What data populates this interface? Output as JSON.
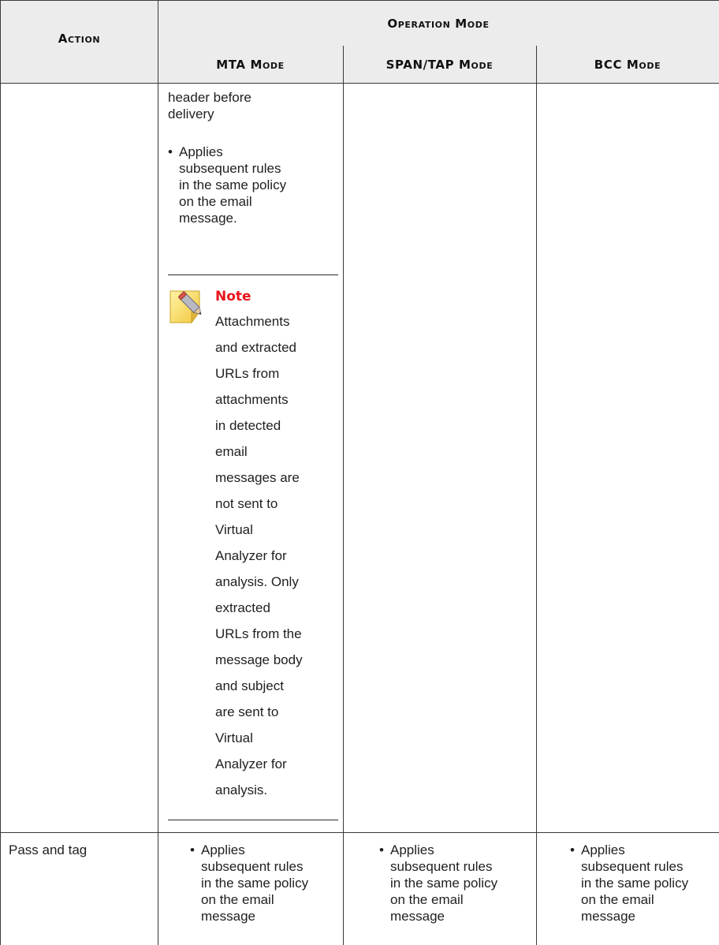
{
  "table": {
    "headers": {
      "action": "Action",
      "operation_mode": "Operation Mode",
      "mta": "MTA Mode",
      "span_tap": "SPAN/TAP Mode",
      "bcc": "BCC Mode"
    },
    "row_continuation": {
      "mta_lines": [
        "header before",
        "delivery"
      ],
      "mta_bullet_lines": [
        "Applies",
        "subsequent rules",
        "in the same policy",
        "on the email",
        "message."
      ],
      "note": {
        "title": "Note",
        "icon": "note-pencil-icon",
        "lines": [
          "Attachments",
          "and extracted",
          "URLs from",
          "attachments",
          "in detected",
          "email",
          "messages are",
          "not sent to",
          "Virtual",
          "Analyzer for",
          "analysis. Only",
          "extracted",
          "URLs from the",
          "message body",
          "and subject",
          "are sent to",
          "Virtual",
          "Analyzer for",
          "analysis."
        ]
      }
    },
    "row_pass_tag": {
      "action": "Pass and tag",
      "mta_lines": [
        "Applies",
        "subsequent rules",
        "in the same policy",
        "on the email",
        "message"
      ],
      "span_lines": [
        "Applies",
        "subsequent rules",
        "in the same policy",
        "on the email",
        "message"
      ],
      "bcc_lines": [
        "Applies",
        "subsequent rules",
        "in the same policy",
        "on the email",
        "message"
      ]
    },
    "bullet_glyph": "•"
  }
}
